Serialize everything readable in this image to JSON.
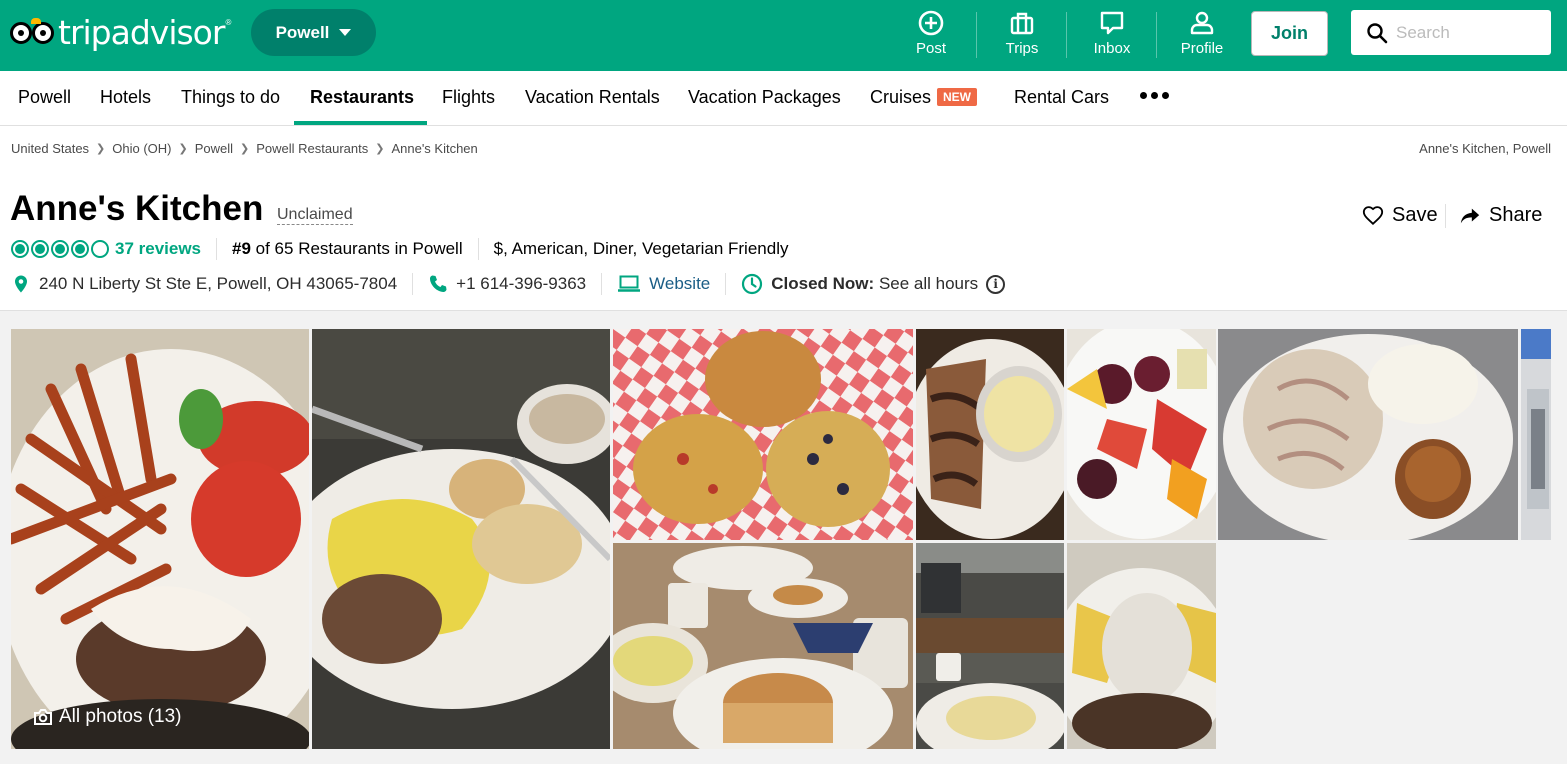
{
  "brand": {
    "name_part1": "trip",
    "name_part2": "advisor",
    "reg": "®"
  },
  "geo": {
    "label": "Powell"
  },
  "header_actions": [
    {
      "label": "Post",
      "icon": "plus-circle-icon"
    },
    {
      "label": "Trips",
      "icon": "suitcase-icon"
    },
    {
      "label": "Inbox",
      "icon": "chat-bubble-icon"
    },
    {
      "label": "Profile",
      "icon": "person-icon"
    }
  ],
  "join_label": "Join",
  "search": {
    "placeholder": "Search"
  },
  "subnav": {
    "items": [
      "Powell",
      "Hotels",
      "Things to do",
      "Restaurants",
      "Flights",
      "Vacation Rentals",
      "Vacation Packages",
      "Cruises",
      "Rental Cars"
    ],
    "active": "Restaurants",
    "new_badge": "NEW"
  },
  "breadcrumbs": [
    "United States",
    "Ohio (OH)",
    "Powell",
    "Powell Restaurants",
    "Anne's Kitchen"
  ],
  "breadcrumb_right": "Anne's Kitchen, Powell",
  "restaurant": {
    "name": "Anne's Kitchen",
    "claim_status": "Unclaimed",
    "rating_bubbles": 4,
    "rating_max": 5,
    "reviews": "37 reviews",
    "rank_num": "#9",
    "rank_text": " of 65 Restaurants in Powell",
    "price": "$",
    "cuisines_sep": ", ",
    "cuisine_1": "American",
    "cuisine_2": "Diner",
    "cuisine_3": "Vegetarian Friendly",
    "address": "240 N Liberty St Ste E, Powell, OH 43065-7804",
    "phone": "+1 614-396-9363",
    "website": "Website",
    "status_label": "Closed Now:",
    "hours_link": "See all hours",
    "info_glyph": "i"
  },
  "actions": {
    "save": "Save",
    "share": "Share"
  },
  "photos": {
    "all_label": "All photos (13)"
  },
  "colors": {
    "brand_green": "#00a680",
    "dark_green": "#00806b",
    "new_badge": "#ef6945",
    "link_blue": "#1a5d86"
  }
}
